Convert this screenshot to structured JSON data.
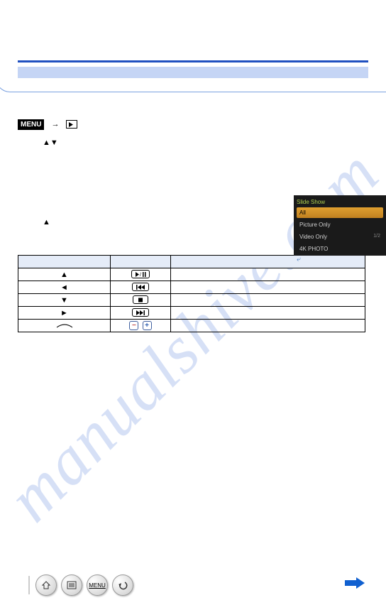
{
  "watermark": "manualshive.com",
  "header": {
    "menu_label": "MENU"
  },
  "instructions": {
    "arrows_select": "▲▼",
    "arrow_start": "▲"
  },
  "camera_menu": {
    "title": "Slide Show",
    "items": [
      "All",
      "Picture Only",
      "Video Only",
      "4K PHOTO"
    ],
    "page": "1/2"
  },
  "controls_table": {
    "headers": [
      "",
      "",
      ""
    ],
    "rows": [
      {
        "key": "▲",
        "icon": "play-pause",
        "desc": ""
      },
      {
        "key": "◄",
        "icon": "prev",
        "desc": ""
      },
      {
        "key": "▼",
        "icon": "stop",
        "desc": ""
      },
      {
        "key": "►",
        "icon": "next",
        "desc": ""
      },
      {
        "key": "dial",
        "icon": "volume",
        "desc": ""
      }
    ]
  },
  "bottom_nav": {
    "items": [
      "home",
      "list",
      "menu",
      "back"
    ],
    "menu_label": "MENU"
  }
}
